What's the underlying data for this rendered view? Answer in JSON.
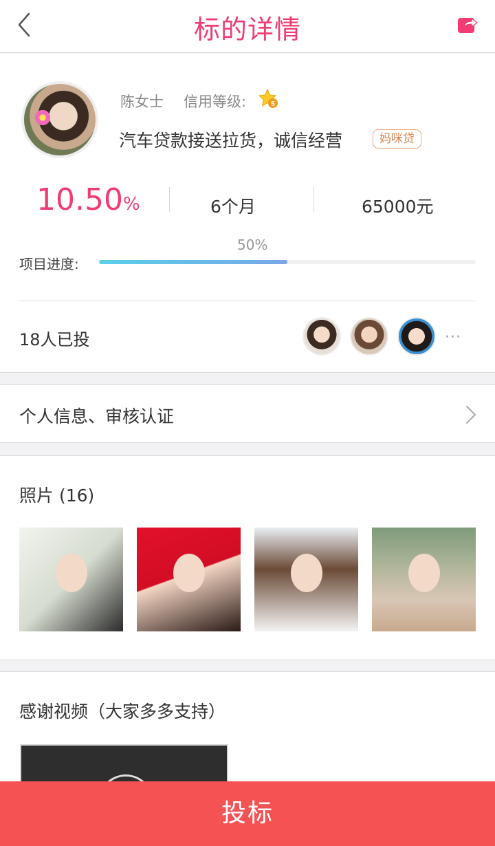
{
  "header": {
    "title": "标的详情",
    "back_icon": "chevron-left-icon",
    "share_icon": "share-icon"
  },
  "colors": {
    "accent": "#f03c73",
    "cta": "#f55254",
    "progress_start": "#58d0e8",
    "progress_end": "#7aa6e8"
  },
  "borrower": {
    "name": "陈女士",
    "credit_label": "信用等级:",
    "credit_level": "5",
    "headline": "汽车贷款接送拉货，诚信经营",
    "tag": "妈咪贷"
  },
  "stats": {
    "rate": "10.50",
    "rate_unit": "%",
    "term": "6个月",
    "amount": "65000元"
  },
  "progress": {
    "label": "项目进度:",
    "percent_text": "50%",
    "value": 0.5
  },
  "investors": {
    "label": "18人已投",
    "more": "···"
  },
  "info_row": {
    "label": "个人信息、审核认证"
  },
  "photos": {
    "label": "照片 (16)"
  },
  "video": {
    "label": "感谢视频（大家多多支持）"
  },
  "cta": {
    "label": "投标"
  }
}
